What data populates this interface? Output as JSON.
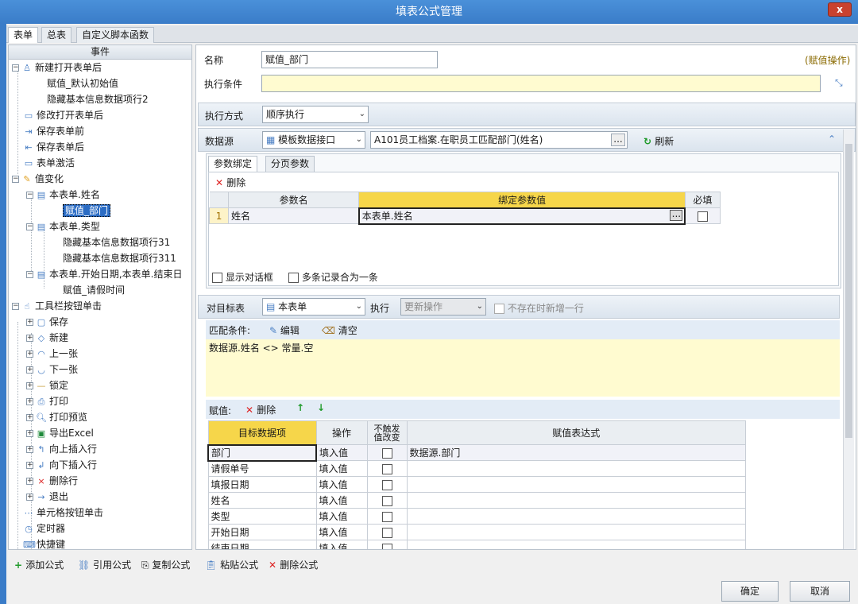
{
  "window": {
    "title": "填表公式管理",
    "close": "x"
  },
  "tabs": [
    "表单",
    "总表",
    "自定义脚本函数"
  ],
  "tree": {
    "header": "事件",
    "nodes": [
      {
        "label": "新建打开表单后"
      },
      {
        "label": "赋值_默认初始值"
      },
      {
        "label": "隐藏基本信息数据项行2"
      },
      {
        "label": "修改打开表单后"
      },
      {
        "label": "保存表单前"
      },
      {
        "label": "保存表单后"
      },
      {
        "label": "表单激活"
      },
      {
        "label": "值变化"
      },
      {
        "label": "本表单.姓名"
      },
      {
        "label": "赋值_部门"
      },
      {
        "label": "本表单.类型"
      },
      {
        "label": "隐藏基本信息数据项行31"
      },
      {
        "label": "隐藏基本信息数据项行311"
      },
      {
        "label": "本表单.开始日期,本表单.结束日"
      },
      {
        "label": "赋值_请假时间"
      },
      {
        "label": "工具栏按钮单击"
      },
      {
        "label": "保存"
      },
      {
        "label": "新建"
      },
      {
        "label": "上一张"
      },
      {
        "label": "下一张"
      },
      {
        "label": "锁定"
      },
      {
        "label": "打印"
      },
      {
        "label": "打印预览"
      },
      {
        "label": "导出Excel"
      },
      {
        "label": "向上插入行"
      },
      {
        "label": "向下插入行"
      },
      {
        "label": "删除行"
      },
      {
        "label": "退出"
      },
      {
        "label": "单元格按钮单击"
      },
      {
        "label": "定时器"
      },
      {
        "label": "快捷键"
      }
    ]
  },
  "form": {
    "name_label": "名称",
    "name_value": "赋值_部门",
    "op_type": "(赋值操作)",
    "cond_label": "执行条件",
    "cond_value": "",
    "exec_mode_label": "执行方式",
    "exec_mode_value": "顺序执行",
    "ds_label": "数据源",
    "ds_type": "模板数据接口",
    "ds_value": "A101员工档案.在职员工匹配部门(姓名)",
    "ds_browse": "...",
    "refresh": "刷新",
    "param_tabs": [
      "参数绑定",
      "分页参数"
    ],
    "param_delete": "删除",
    "param_headers": [
      "参数名",
      "绑定参数值",
      "必填"
    ],
    "param_rows": [
      {
        "idx": "1",
        "name": "姓名",
        "value": "本表单.姓名",
        "btn": "..."
      }
    ],
    "show_dialog": "显示对话框",
    "merge_records": "多条记录合为一条",
    "target_label": "对目标表",
    "target_value": "本表单",
    "exec_label": "执行",
    "exec_value": "更新操作",
    "add_if_missing": "不存在时新增一行",
    "match_label": "匹配条件:",
    "edit": "编辑",
    "clear": "清空",
    "match_expr": "数据源.姓名 <> 常量.空",
    "assign_label": "赋值:",
    "assign_delete": "删除",
    "assign_headers": [
      "目标数据项",
      "操作",
      "不触发值改变",
      "赋值表达式"
    ],
    "assign_rows": [
      {
        "target": "部门",
        "op": "填入值",
        "expr": "数据源.部门"
      },
      {
        "target": "请假单号",
        "op": "填入值",
        "expr": ""
      },
      {
        "target": "填报日期",
        "op": "填入值",
        "expr": ""
      },
      {
        "target": "姓名",
        "op": "填入值",
        "expr": ""
      },
      {
        "target": "类型",
        "op": "填入值",
        "expr": ""
      },
      {
        "target": "开始日期",
        "op": "填入值",
        "expr": ""
      },
      {
        "target": "结束日期",
        "op": "填入值",
        "expr": ""
      }
    ]
  },
  "bottom": {
    "add": "添加公式",
    "ref": "引用公式",
    "copy": "复制公式",
    "paste": "粘贴公式",
    "del": "删除公式",
    "ok": "确定",
    "cancel": "取消"
  }
}
